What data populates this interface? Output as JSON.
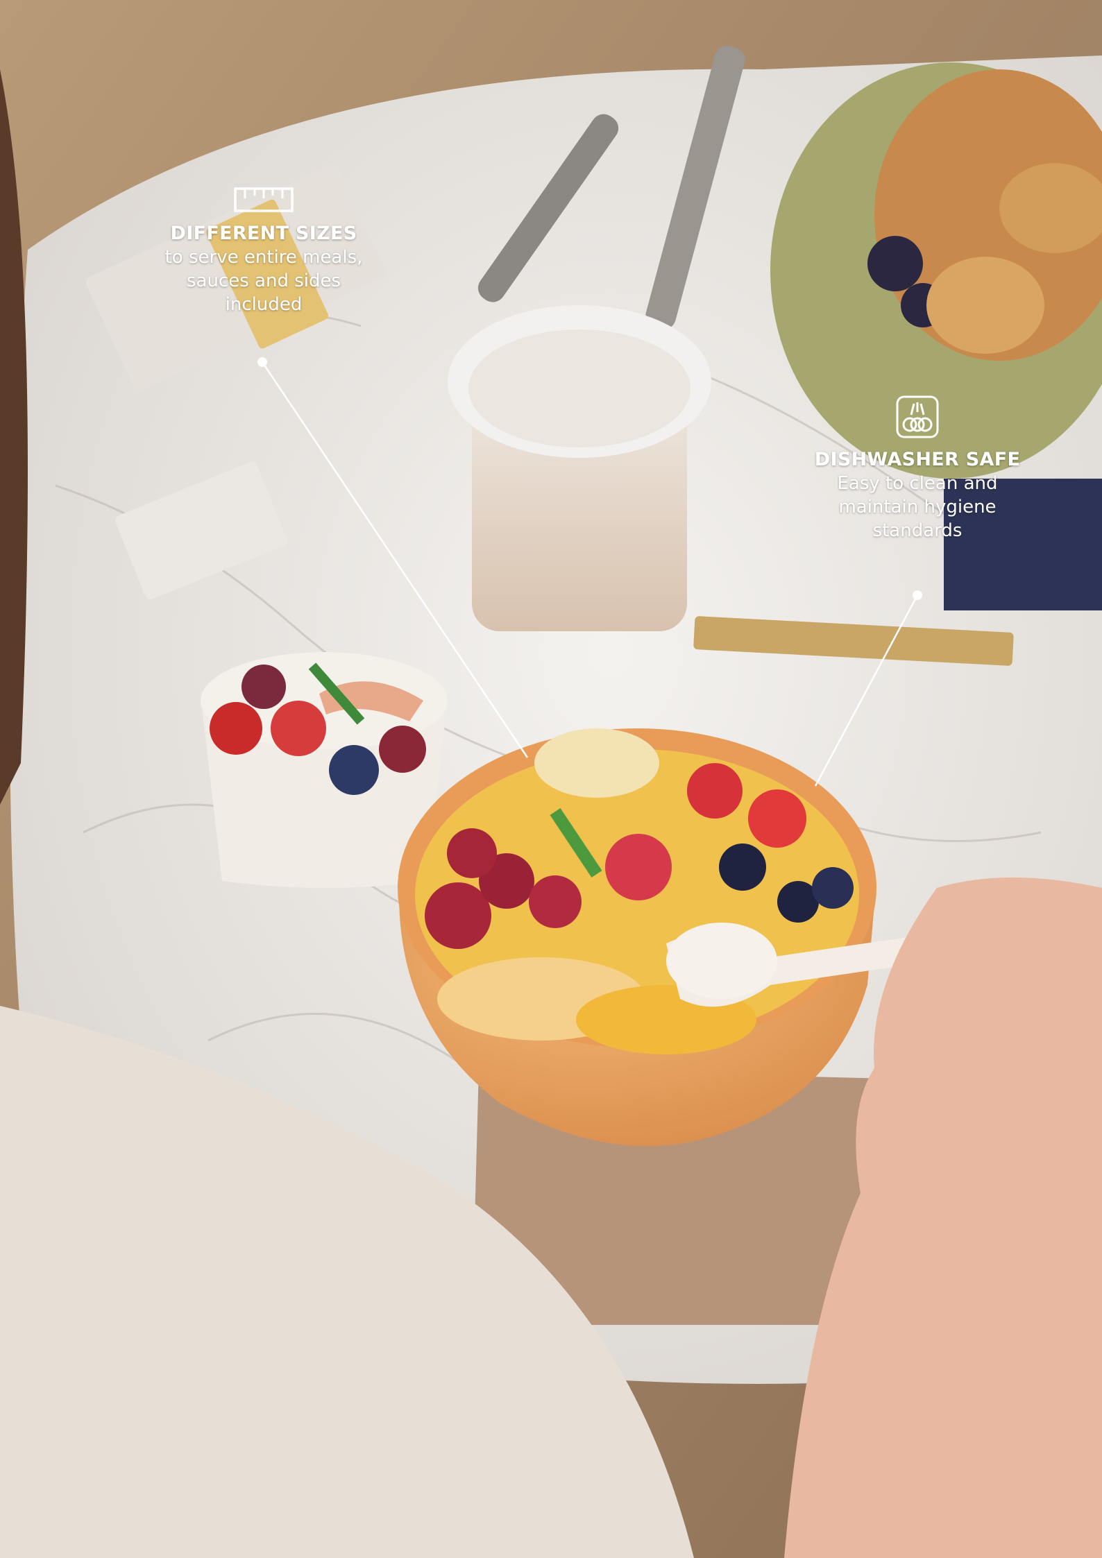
{
  "callouts": {
    "sizes": {
      "icon": "ruler-icon",
      "heading": "DIFFERENT SIZES",
      "lines": [
        "to serve entire meals,",
        "sauces and sides",
        "included"
      ]
    },
    "dishwasher": {
      "icon": "dishwasher-icon",
      "heading": "DISHWASHER SAFE",
      "lines": [
        "Easy to clean and",
        "maintain hygiene",
        "standards"
      ]
    }
  },
  "colors": {
    "callout_text": "#ffffff",
    "bowl": "#e8a565",
    "marble": "#e9e6e2",
    "napkin": "#b69479"
  }
}
